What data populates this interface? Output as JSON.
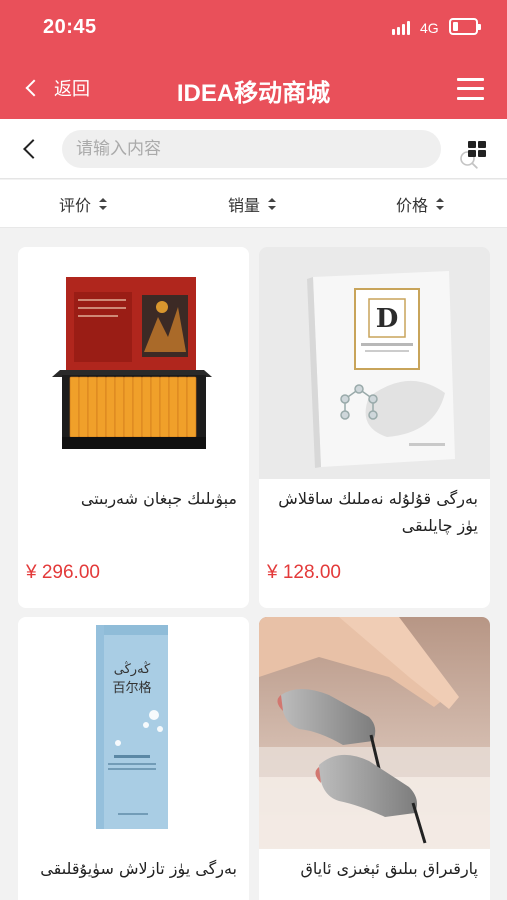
{
  "status_bar": {
    "time": "20:45",
    "network": "4G"
  },
  "nav": {
    "back_label": "返回",
    "title": "IDEA移动商城"
  },
  "search": {
    "placeholder": "请输入内容"
  },
  "sort": [
    {
      "label": "评价"
    },
    {
      "label": "销量"
    },
    {
      "label": "价格"
    }
  ],
  "products": [
    {
      "name": "مېۋىلىك جېغان شەربىتى",
      "price": "¥ 296.00"
    },
    {
      "name": "بەرگى قۇلۇلە نەملىك ساقلاش يۈز چايلىقى",
      "price": "¥ 128.00"
    },
    {
      "name": "بەرگى يۈز تازلاش سۈيۇقلىقى",
      "price": ""
    },
    {
      "name": "پارقىراق بىلىق ئېغىزى ئاياق",
      "price": ""
    }
  ],
  "images": {
    "p1_box_label": "",
    "p2_logo": "D",
    "p3_brand": "百尔格"
  },
  "colors": {
    "accent": "#e9505a",
    "price": "#e33a3a"
  },
  "icons": [
    "back-icon",
    "menu-icon",
    "search-icon",
    "grid-view-icon",
    "sort-icon"
  ]
}
